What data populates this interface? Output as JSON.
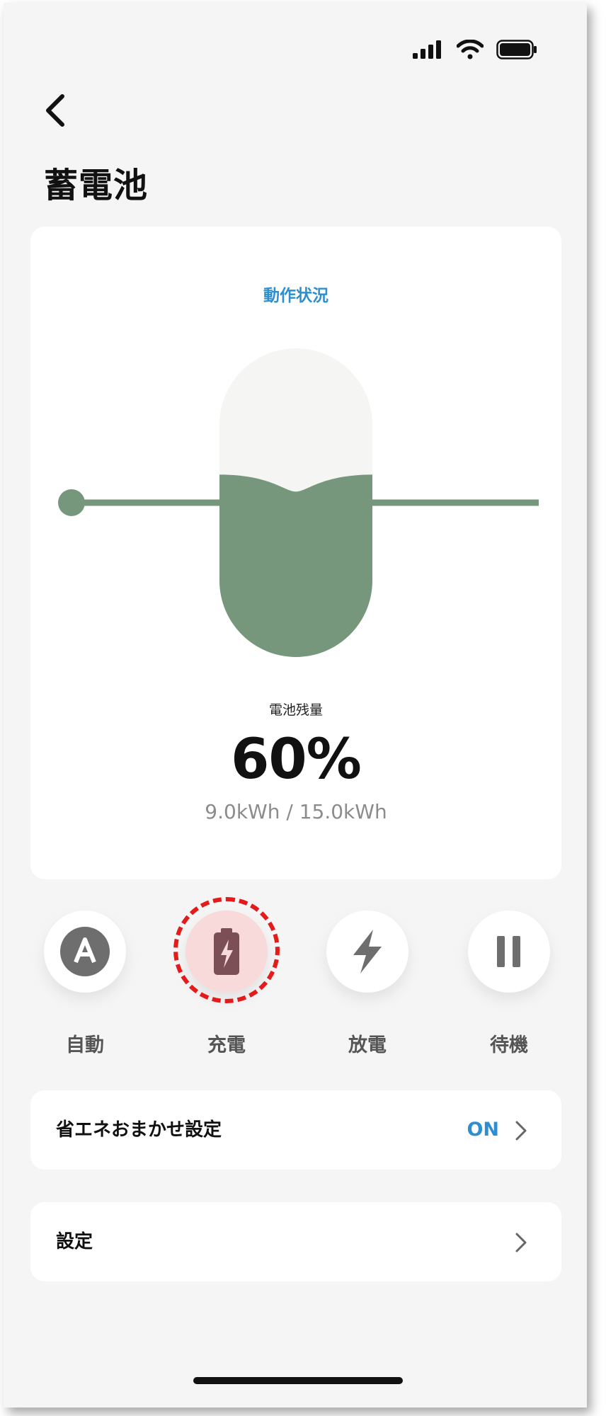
{
  "header": {
    "title": "蓄電池",
    "back_icon": "chevron-left-icon"
  },
  "status_bar": {
    "icons": [
      "cellular-signal-icon",
      "wifi-icon",
      "battery-icon"
    ]
  },
  "status_card": {
    "status_label": "動作状況",
    "battery_level_label": "電池残量",
    "battery_level_value": "60%",
    "battery_level_fraction": 0.6,
    "capacity": "9.0kWh / 15.0kWh",
    "colors": {
      "fill": "#76977c",
      "line": "#76977c",
      "empty": "#f5f5f3"
    }
  },
  "modes": [
    {
      "id": "auto",
      "label": "自動",
      "icon": "auto-a-icon",
      "active": false
    },
    {
      "id": "charge",
      "label": "充電",
      "icon": "battery-charging-icon",
      "active": true
    },
    {
      "id": "discharge",
      "label": "放電",
      "icon": "lightning-bolt-icon",
      "active": false
    },
    {
      "id": "standby",
      "label": "待機",
      "icon": "pause-icon",
      "active": false
    }
  ],
  "settings": {
    "eco_label": "省エネおまかせ設定",
    "eco_value": "ON",
    "settings_label": "設定"
  },
  "colors": {
    "accent": "#2d8fd0",
    "highlight": "#e41b1b",
    "active_bg": "#f8dada"
  }
}
